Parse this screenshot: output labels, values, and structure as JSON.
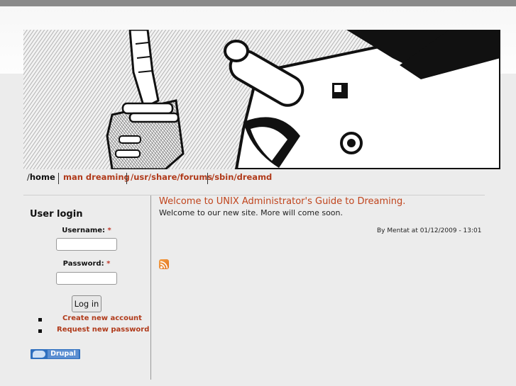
{
  "banner": {
    "alt": "robot-illustration"
  },
  "nav": {
    "items": [
      {
        "prefix": "/",
        "label": "home",
        "active": true
      },
      {
        "label": "man dreaming"
      },
      {
        "label": "/usr/share/forums"
      },
      {
        "label": "/sbin/dreamd"
      }
    ]
  },
  "login": {
    "title": "User login",
    "username_label": "Username:",
    "password_label": "Password:",
    "required_mark": "*",
    "username_value": "",
    "password_value": "",
    "button_label": "Log in",
    "links": [
      "Create new account",
      "Request new password"
    ]
  },
  "node": {
    "title": "Welcome to UNIX Administrator's Guide to Dreaming.",
    "body": "Welcome to our new site. More will come soon.",
    "meta": "By Mentat at 01/12/2009 - 13:01"
  },
  "footer": {
    "badge": "Drupal"
  },
  "icons": {
    "feed": "rss-feed-icon",
    "powered": "drupal-logo-icon"
  }
}
